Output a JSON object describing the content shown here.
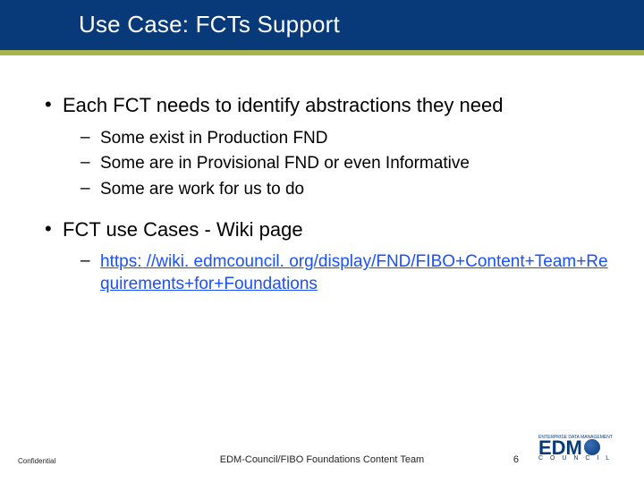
{
  "title": "Use Case: FCTs Support",
  "bullets": {
    "b1_a": "Each FCT needs to identify abstractions they need",
    "b1_a_sub1": "Some exist in Production FND",
    "b1_a_sub2": "Some are in Provisional FND or even Informative",
    "b1_a_sub3": "Some are work for us to do",
    "b1_b": "FCT use Cases - Wiki page",
    "b1_b_sub1_link": "https: //wiki. edmcouncil. org/display/FND/FIBO+Content+Team+Requirements+for+Foundations"
  },
  "footer": {
    "confidential": "Confidential",
    "center": "EDM-Council/FIBO Foundations Content Team",
    "page": "6"
  },
  "logo": {
    "tagline": "ENTERPRISE DATA MANAGEMENT",
    "main": "EDM",
    "sub": "C O U N C I L"
  }
}
